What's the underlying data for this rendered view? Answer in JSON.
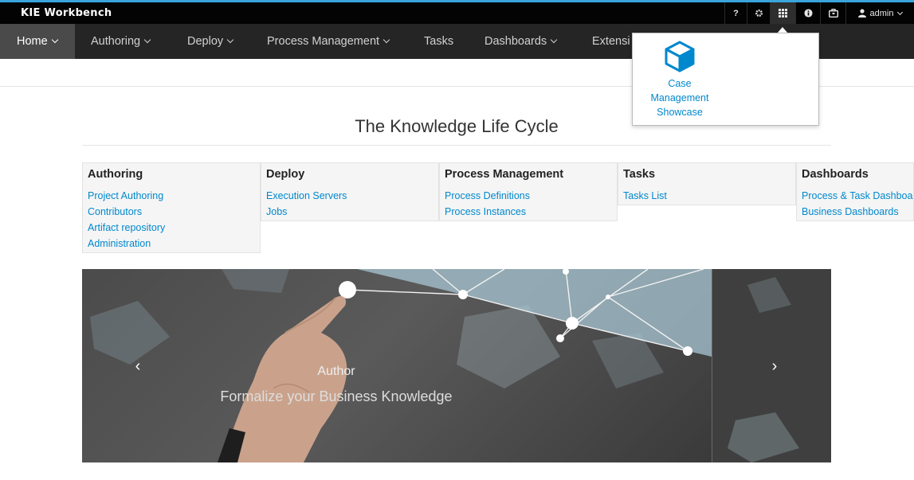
{
  "header": {
    "brand": "KIE Workbench",
    "help_label": "?",
    "user_label": "admin",
    "icons": [
      "help-icon",
      "gear-icon",
      "apps-grid-icon",
      "info-icon",
      "briefcase-icon",
      "user-icon"
    ]
  },
  "nav": {
    "items": [
      {
        "label": "Home",
        "dropdown": true,
        "active": true
      },
      {
        "label": "Authoring",
        "dropdown": true
      },
      {
        "label": "Deploy",
        "dropdown": true
      },
      {
        "label": "Process Management",
        "dropdown": true
      },
      {
        "label": "Tasks",
        "dropdown": false
      },
      {
        "label": "Dashboards",
        "dropdown": true
      },
      {
        "label": "Extensi",
        "dropdown": false
      }
    ]
  },
  "apps_menu": {
    "items": [
      {
        "label": "Case Management Showcase",
        "icon": "cube-icon"
      }
    ]
  },
  "main": {
    "title": "The Knowledge Life Cycle",
    "columns": [
      {
        "heading": "Authoring",
        "links": [
          "Project Authoring",
          "Contributors",
          "Artifact repository",
          "Administration"
        ]
      },
      {
        "heading": "Deploy",
        "links": [
          "Execution Servers",
          "Jobs"
        ]
      },
      {
        "heading": "Process Management",
        "links": [
          "Process Definitions",
          "Process Instances"
        ]
      },
      {
        "heading": "Tasks",
        "links": [
          "Tasks List"
        ]
      },
      {
        "heading": "Dashboards",
        "links": [
          "Process & Task Dashboard",
          "Business Dashboards"
        ]
      }
    ]
  },
  "carousel": {
    "caption_title": "Author",
    "caption_text": "Formalize your Business Knowledge",
    "prev_label": "‹",
    "next_label": "›"
  },
  "colors": {
    "accent": "#39a5dc",
    "topbar": "#030303",
    "navbar": "#252525",
    "link": "#0088ce"
  }
}
